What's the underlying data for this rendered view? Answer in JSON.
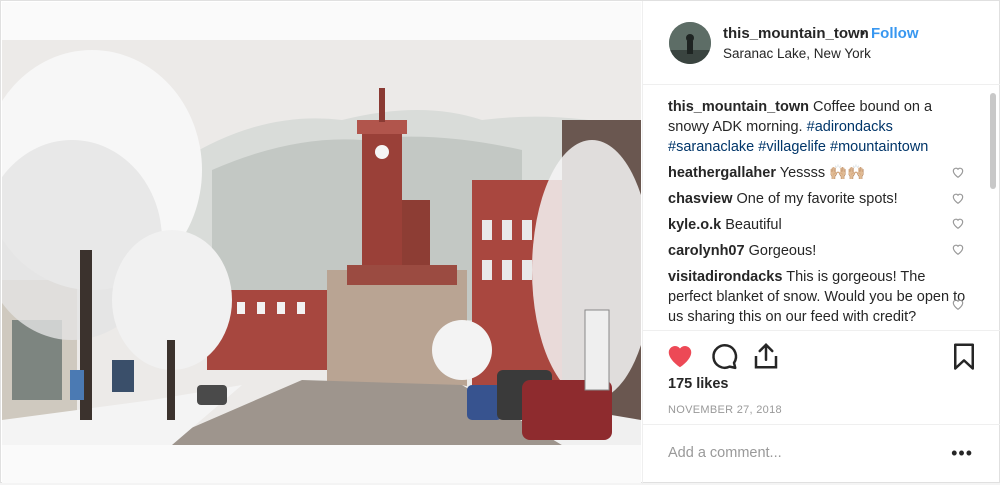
{
  "post": {
    "username": "this_mountain_town",
    "separator": "•",
    "follow_label": "Follow",
    "location": "Saranac Lake, New York",
    "caption_text": "Coffee bound on a snowy ADK morning.",
    "hashtags": "#adirondacks #saranaclake #villagelife #mountaintown",
    "likes": "175 likes",
    "date": "NOVEMBER 27, 2018",
    "add_comment_placeholder": "Add a comment...",
    "more_label": "•••"
  },
  "comments": [
    {
      "user": "heathergallaher",
      "text": "Yessss 🙌🏼🙌🏼"
    },
    {
      "user": "chasview",
      "text": "One of my favorite spots!"
    },
    {
      "user": "kyle.o.k",
      "text": "Beautiful"
    },
    {
      "user": "carolynh07",
      "text": "Gorgeous!"
    },
    {
      "user": "visitadirondacks",
      "text": "This is gorgeous! The perfect blanket of snow. Would you be open to us sharing this on our feed with credit?"
    }
  ],
  "icons": {
    "like": "heart-filled-icon",
    "comment": "comment-bubble-icon",
    "share": "share-icon",
    "save": "bookmark-icon",
    "comment_like": "heart-outline-icon"
  },
  "colors": {
    "like": "#ed4956",
    "link": "#3897f0",
    "hashtag": "#003569"
  }
}
